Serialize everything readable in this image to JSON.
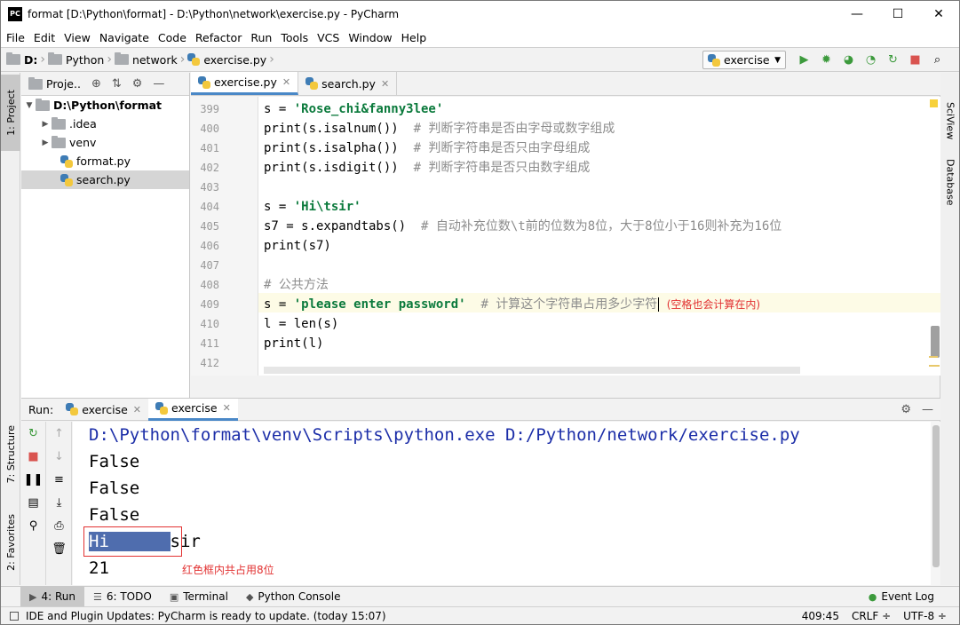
{
  "window": {
    "title": "format [D:\\Python\\format] - D:\\Python\\network\\exercise.py - PyCharm",
    "app_icon": "PC",
    "minimize": "—",
    "maximize": "☐",
    "close": "✕"
  },
  "menu": [
    "File",
    "Edit",
    "View",
    "Navigate",
    "Code",
    "Refactor",
    "Run",
    "Tools",
    "VCS",
    "Window",
    "Help"
  ],
  "breadcrumb": [
    "D:",
    "Python",
    "network",
    "exercise.py"
  ],
  "run_config": {
    "label": "exercise"
  },
  "project": {
    "header": "Proje..",
    "root": "D:\\Python\\format",
    "items": [
      ".idea",
      "venv",
      "format.py",
      "search.py"
    ]
  },
  "editor_tabs": [
    {
      "label": "exercise.py",
      "active": true
    },
    {
      "label": "search.py",
      "active": false
    }
  ],
  "code": {
    "line_numbers": [
      "399",
      "400",
      "401",
      "402",
      "403",
      "404",
      "405",
      "406",
      "407",
      "408",
      "409",
      "410",
      "411",
      "412"
    ],
    "lines": {
      "l399a": "s = ",
      "l399b": "'Rose_chi&fanny3lee'",
      "l400a": "print(s.isalnum())  ",
      "l400b": "# 判断字符串是否由字母或数字组成",
      "l401a": "print(s.isalpha())  ",
      "l401b": "# 判断字符串是否只由字母组成",
      "l402a": "print(s.isdigit())  ",
      "l402b": "# 判断字符串是否只由数字组成",
      "l404a": "s = ",
      "l404b": "'Hi\\tsir'",
      "l405a": "s7 = s.expandtabs()  ",
      "l405b": "# 自动补充位数\\t前的位数为8位，大于8位小于16则补充为16位",
      "l406": "print(s7)",
      "l408": "# 公共方法",
      "l409a": "s = ",
      "l409b": "'please enter password'",
      "l409c": "  # 计算这个字符串占用多少字符",
      "l410": "l = len(s)",
      "l411": "print(l)"
    },
    "annotation": "(空格也会计算在内)"
  },
  "run_panel": {
    "label": "Run:",
    "tabs": [
      "exercise",
      "exercise"
    ]
  },
  "console": {
    "lines": [
      "D:\\Python\\format\\venv\\Scripts\\python.exe D:/Python/network/exercise.py",
      "False",
      "False",
      "False"
    ],
    "hi": "Hi      ",
    "sir": "sir",
    "result": "21",
    "red_note": "红色框内共占用8位"
  },
  "bottom_tabs": [
    {
      "label": "4: Run",
      "icon": "▶"
    },
    {
      "label": "6: TODO",
      "icon": "☰"
    },
    {
      "label": "Terminal",
      "icon": "▣"
    },
    {
      "label": "Python Console",
      "icon": "◆"
    }
  ],
  "event_log": "Event Log",
  "status": {
    "message": "IDE and Plugin Updates: PyCharm is ready to update. (today 15:07)",
    "position": "409:45",
    "line_sep": "CRLF ÷",
    "encoding": "UTF-8 ÷"
  },
  "side_tabs": {
    "left": [
      "1: Project",
      "7: Structure",
      "2: Favorites"
    ],
    "right": [
      "SciView",
      "Database"
    ]
  }
}
